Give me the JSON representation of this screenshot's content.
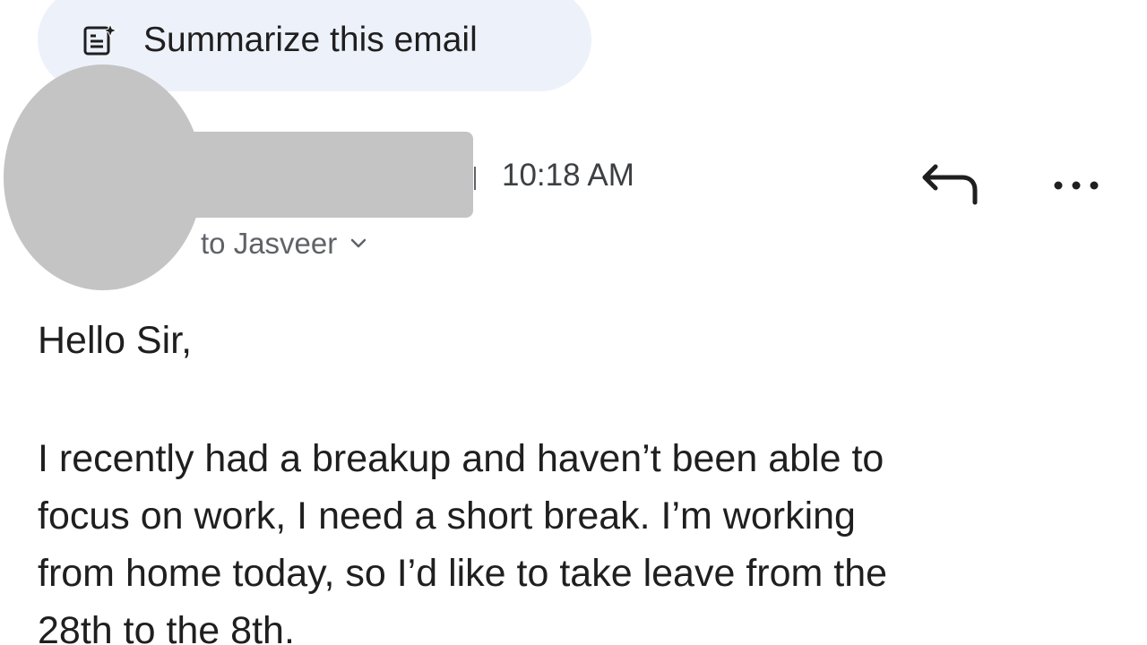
{
  "summarize": {
    "label": "Summarize this email",
    "icon": "summarize-sparkle-icon"
  },
  "sender": {
    "avatar": "avatar-redacted",
    "name_redacted": true
  },
  "message_header": {
    "time": "10:18 AM",
    "recipient_label": "to Jasveer",
    "reply_icon": "reply-icon",
    "more_icon": "more-horizontal-icon",
    "chevron_icon": "chevron-down-icon"
  },
  "message_body": {
    "greeting": "Hello Sir,",
    "paragraph_lines": [
      "I recently had a breakup and haven’t been able to",
      "focus on work, I need a short break. I’m working",
      "from home today, so I’d like to take leave from the",
      "28th to the 8th."
    ]
  },
  "colors": {
    "chip_background": "#edf1fa",
    "redaction_gray": "#c4c4c4",
    "text_primary": "#1f1f1f",
    "text_secondary": "#5f6368"
  }
}
